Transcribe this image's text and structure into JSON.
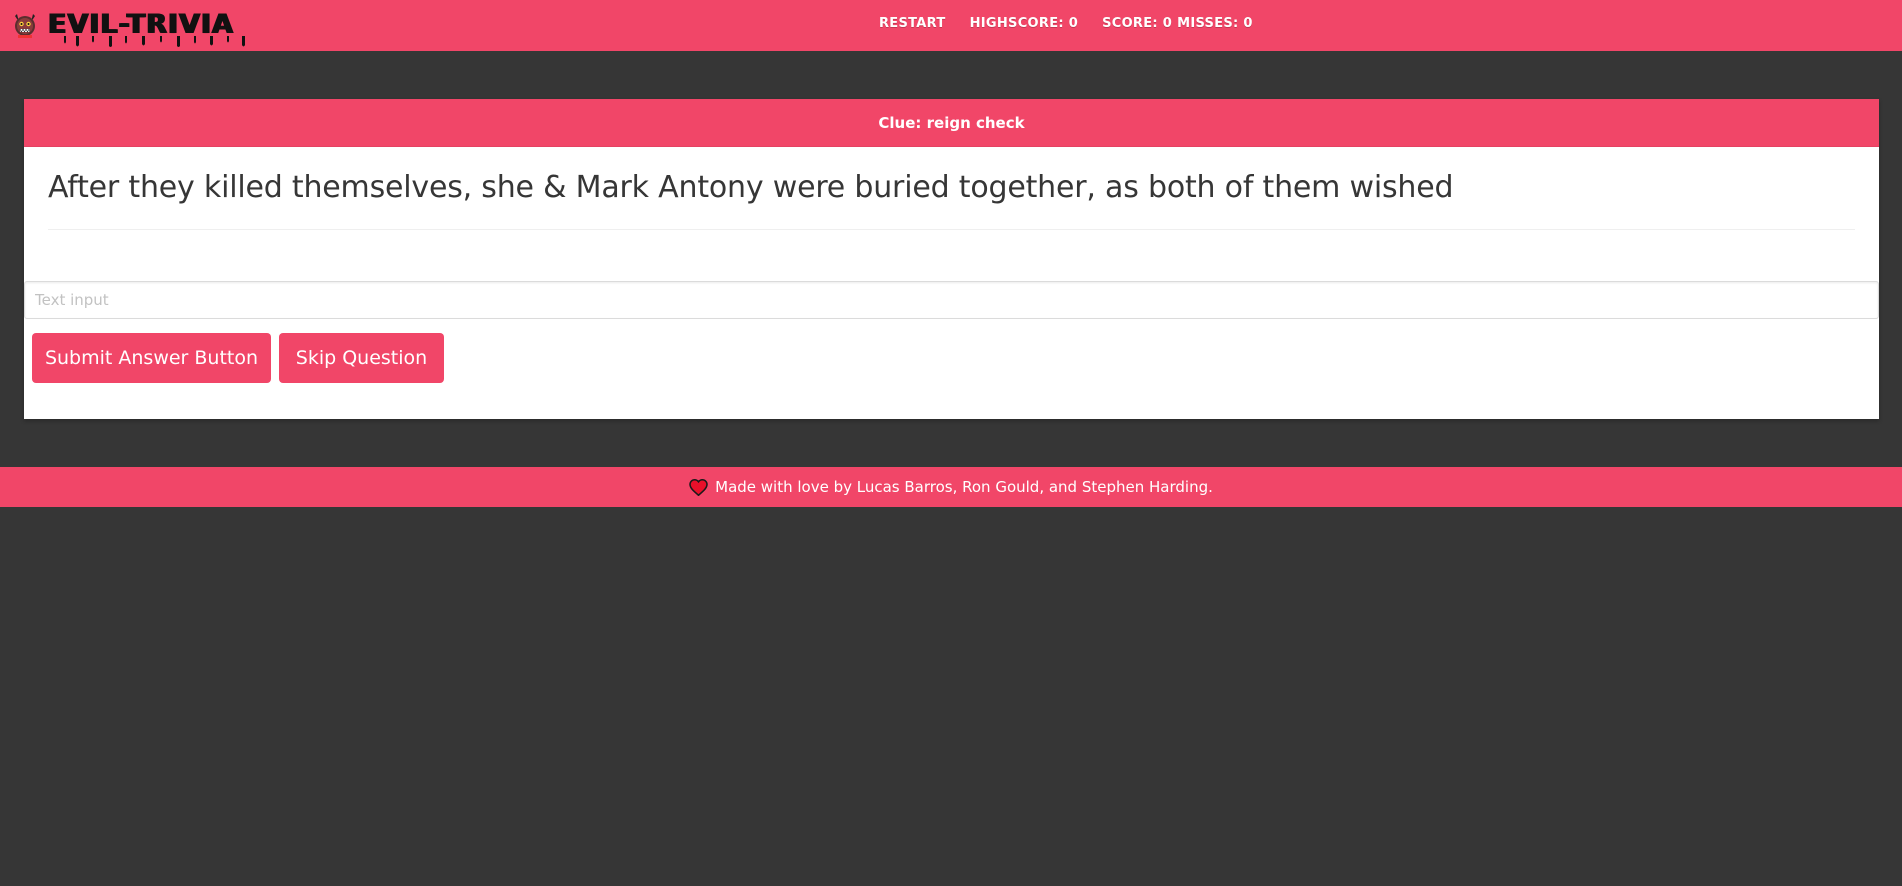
{
  "navbar": {
    "logo_text": "EVIL-TRIVIA",
    "logo_icon": "demon-mascot-icon",
    "restart_label": "RESTART",
    "highscore_label": "HIGHSCORE: 0",
    "score_label": "SCORE: 0",
    "misses_label": "MISSES: 0"
  },
  "card": {
    "clue": "Clue: reign check",
    "question": "After they killed themselves, she & Mark Antony were buried together, as both of them wished",
    "input_placeholder": "Text input",
    "input_value": "",
    "submit_label": "Submit Answer Button",
    "skip_label": "Skip Question"
  },
  "footer": {
    "heart_icon": "heart-icon",
    "text": "Made with love by Lucas Barros, Ron Gould, and Stephen Harding."
  },
  "colors": {
    "accent": "#f14668",
    "background": "#363636",
    "card": "#ffffff",
    "text_dark": "#363636"
  }
}
